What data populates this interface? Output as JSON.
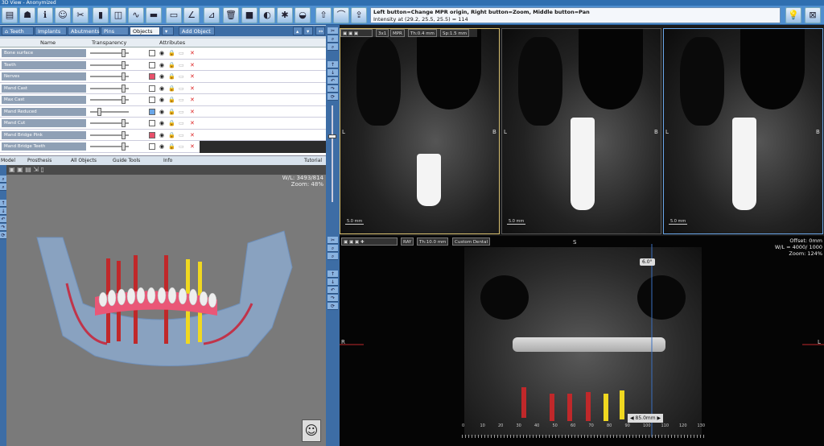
{
  "window": {
    "title": "3D View - Anonymized"
  },
  "message": {
    "line1": "Left button=Change MPR origin, Right button=Zoom, Middle button=Pan",
    "line2": "Intensity at (29.2, 25.5, 25.5) = 114"
  },
  "tabs": [
    "Teeth",
    "Implants",
    "Abutments",
    "Pins",
    "Objects",
    "Add Object"
  ],
  "table": {
    "headers": [
      "Name",
      "Transparency",
      "Attributes"
    ],
    "rows": [
      {
        "name": "Bone surface",
        "knob": 0.9,
        "swatch": ""
      },
      {
        "name": "Teeth",
        "knob": 0.9,
        "swatch": ""
      },
      {
        "name": "Nerves",
        "knob": 0.9,
        "swatch": "#e8506a"
      },
      {
        "name": "Mand Cast",
        "knob": 0.9,
        "swatch": ""
      },
      {
        "name": "Max Cast",
        "knob": 0.9,
        "swatch": ""
      },
      {
        "name": "Mand Reduced",
        "knob": 0.2,
        "swatch": "#6aa6e8"
      },
      {
        "name": "Mand Cut",
        "knob": 0.9,
        "swatch": ""
      },
      {
        "name": "Mand Bridge Pink",
        "knob": 0.9,
        "swatch": "#e8506a"
      },
      {
        "name": "Mand Bridge Teeth",
        "knob": 0.9,
        "swatch": ""
      }
    ]
  },
  "modelbar": {
    "model": "Model",
    "prosthesis": "Prosthesis",
    "allobjects": "All Objects",
    "guidetools": "Guide Tools",
    "info": "Info",
    "tutorial": "Tutorial"
  },
  "view3d": {
    "wl": "W/L: 3493/814",
    "zoom": "Zoom: 48%"
  },
  "ctbar": {
    "b1": "3x1",
    "b2": "MPR",
    "b3": "Th:0.4 mm",
    "b4": "Sp:1.5 mm"
  },
  "cross": {
    "label_l": "L",
    "label_b": "B",
    "scale": "5.0 mm"
  },
  "pano": {
    "ray": "RAY",
    "th": "Th:10.0 mm",
    "mode": "Custom Dental",
    "top": "S",
    "left": "R",
    "right": "L",
    "angle": "6.0°",
    "dist": "85.0mm",
    "offset": "Offset: 0mm",
    "wl": "W/L = 4000/ 1000",
    "zoom": "Zoom: 124%",
    "ticks": [
      "0",
      "10",
      "20",
      "30",
      "40",
      "50",
      "60",
      "70",
      "80",
      "90",
      "100",
      "110",
      "120",
      "130"
    ]
  },
  "colors": {
    "toolbar": "#4f8fd0",
    "accent": "#3d6da5",
    "bridge_pink": "#e8506a",
    "implant_red": "#c0282a",
    "implant_yellow": "#f0d820"
  }
}
